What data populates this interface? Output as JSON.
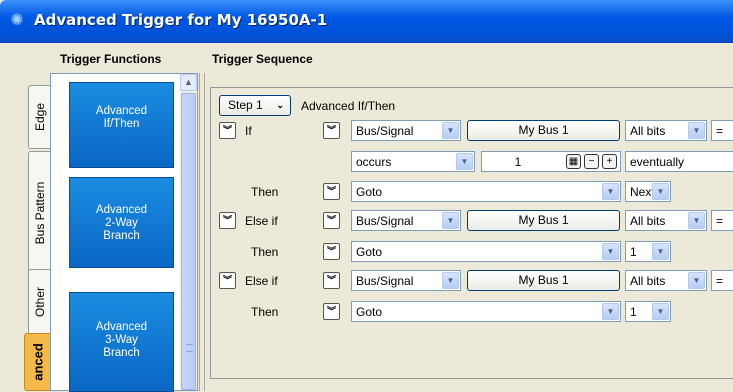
{
  "window": {
    "title": "Advanced Trigger for My 16950A-1",
    "icon": "sparkle-icon"
  },
  "columns": {
    "functions": "Trigger Functions",
    "sequence": "Trigger Sequence"
  },
  "tabs": [
    {
      "label": "Edge",
      "active": false
    },
    {
      "label": "Bus Pattern",
      "active": false
    },
    {
      "label": "Other",
      "active": false
    },
    {
      "label": "anced",
      "active": true
    }
  ],
  "functions": [
    {
      "lines": [
        "Advanced",
        "If/Then"
      ]
    },
    {
      "lines": [
        "Advanced",
        "2-Way",
        "Branch"
      ]
    },
    {
      "lines": [
        "Advanced",
        "3-Way",
        "Branch"
      ]
    }
  ],
  "sequence": {
    "step": {
      "label": "Step 1",
      "title": "Advanced If/Then"
    },
    "rows": [
      {
        "kind": "cond",
        "label": "If",
        "source": "Bus/Signal",
        "bus": "My Bus 1",
        "bits": "All bits",
        "op": "="
      },
      {
        "kind": "occurs",
        "mode": "occurs",
        "count": "1",
        "when": "eventually"
      },
      {
        "kind": "then",
        "label": "Then",
        "action": "Goto",
        "target": "Next"
      },
      {
        "kind": "cond",
        "label": "Else if",
        "source": "Bus/Signal",
        "bus": "My Bus 1",
        "bits": "All bits",
        "op": "="
      },
      {
        "kind": "then",
        "label": "Then",
        "action": "Goto",
        "target": "1"
      },
      {
        "kind": "cond",
        "label": "Else if",
        "source": "Bus/Signal",
        "bus": "My Bus 1",
        "bits": "All bits",
        "op": "="
      },
      {
        "kind": "then",
        "label": "Then",
        "action": "Goto",
        "target": "1"
      }
    ]
  },
  "icons": {
    "expand": "double-chevron-down-icon",
    "calc": "calculator-icon",
    "minus": "minus-icon",
    "plus": "plus-icon"
  },
  "colors": {
    "titlebar": "#0058e6",
    "function_button": "#0a67c4",
    "active_tab": "#f5b94a"
  }
}
